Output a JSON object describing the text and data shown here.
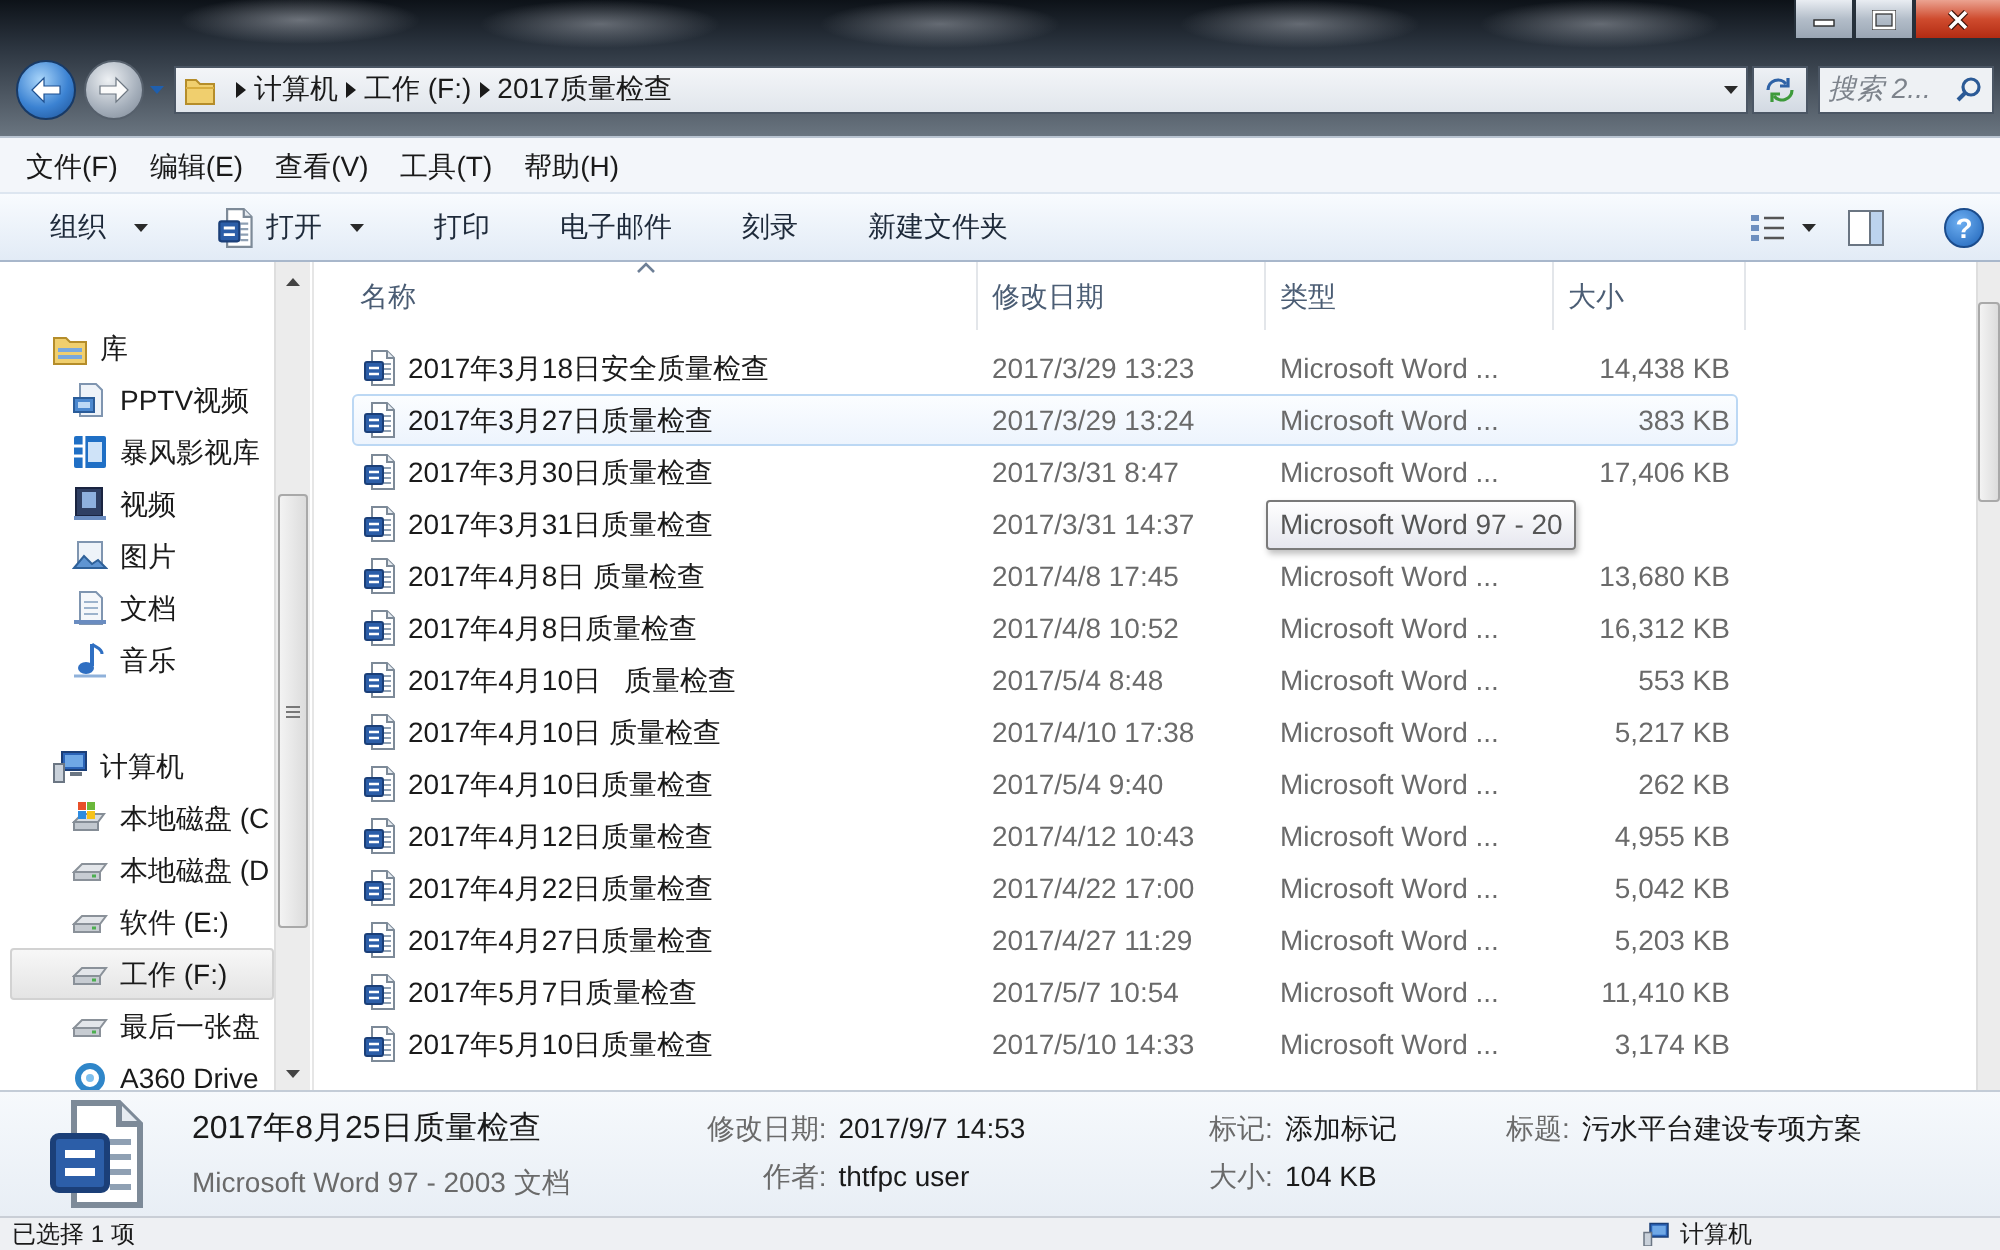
{
  "window": {
    "breadcrumb": [
      "计算机",
      "工作 (F:)",
      "2017质量检查"
    ],
    "search": {
      "placeholder": "搜索 2..."
    }
  },
  "menu": [
    "文件(F)",
    "编辑(E)",
    "查看(V)",
    "工具(T)",
    "帮助(H)"
  ],
  "toolbar": {
    "items": [
      {
        "label": "组织",
        "kind": "menu"
      },
      {
        "label": "打开",
        "kind": "app-menu"
      },
      {
        "label": "打印",
        "kind": "button"
      },
      {
        "label": "电子邮件",
        "kind": "button"
      },
      {
        "label": "刻录",
        "kind": "button"
      },
      {
        "label": "新建文件夹",
        "kind": "button"
      }
    ],
    "help": "?"
  },
  "sidebar": {
    "groups": [
      {
        "label": "库",
        "kind": "library",
        "selected": false,
        "children": [
          {
            "label": "PPTV视频",
            "kind": "video-library",
            "selected": false
          },
          {
            "label": "暴风影视库",
            "kind": "media-library",
            "selected": false
          },
          {
            "label": "视频",
            "kind": "videos",
            "selected": false
          },
          {
            "label": "图片",
            "kind": "pictures",
            "selected": false
          },
          {
            "label": "文档",
            "kind": "documents",
            "selected": false
          },
          {
            "label": "音乐",
            "kind": "music",
            "selected": false
          }
        ]
      },
      {
        "label": "计算机",
        "kind": "computer",
        "selected": false,
        "children": [
          {
            "label": "本地磁盘 (C",
            "kind": "system-drive",
            "selected": false
          },
          {
            "label": "本地磁盘 (D",
            "kind": "drive",
            "selected": false
          },
          {
            "label": "软件 (E:)",
            "kind": "drive",
            "selected": false
          },
          {
            "label": "工作 (F:)",
            "kind": "drive",
            "selected": true
          },
          {
            "label": "最后一张盘",
            "kind": "drive",
            "selected": false
          },
          {
            "label": "A360 Drive",
            "kind": "cloud",
            "selected": false
          }
        ]
      }
    ]
  },
  "file_list": {
    "columns": [
      {
        "label": "名称",
        "sorted": true
      },
      {
        "label": "修改日期",
        "sorted": false
      },
      {
        "label": "类型",
        "sorted": false
      },
      {
        "label": "大小",
        "sorted": false
      }
    ],
    "rows": [
      {
        "name": "2017年3月18日安全质量检查",
        "modified": "2017/3/29 13:23",
        "type": "Microsoft Word ...",
        "size": "14,438 KB",
        "hovered": false
      },
      {
        "name": "2017年3月27日质量检查",
        "modified": "2017/3/29 13:24",
        "type": "Microsoft Word ...",
        "size": "383 KB",
        "hovered": true
      },
      {
        "name": "2017年3月30日质量检查",
        "modified": "2017/3/31 8:47",
        "type": "Microsoft Word ...",
        "size": "17,406 KB",
        "hovered": false
      },
      {
        "name": "2017年3月31日质量检查",
        "modified": "2017/3/31 14:37",
        "tooltip": "Microsoft Word 97 - 20",
        "hovered": false
      },
      {
        "name": "2017年4月8日 质量检查",
        "modified": "2017/4/8 17:45",
        "type": "Microsoft Word ...",
        "size": "13,680 KB",
        "hovered": false
      },
      {
        "name": "2017年4月8日质量检查",
        "modified": "2017/4/8 10:52",
        "type": "Microsoft Word ...",
        "size": "16,312 KB",
        "hovered": false
      },
      {
        "name": "2017年4月10日   质量检查",
        "modified": "2017/5/4 8:48",
        "type": "Microsoft Word ...",
        "size": "553 KB",
        "hovered": false
      },
      {
        "name": "2017年4月10日 质量检查",
        "modified": "2017/4/10 17:38",
        "type": "Microsoft Word ...",
        "size": "5,217 KB",
        "hovered": false
      },
      {
        "name": "2017年4月10日质量检查",
        "modified": "2017/5/4 9:40",
        "type": "Microsoft Word ...",
        "size": "262 KB",
        "hovered": false
      },
      {
        "name": "2017年4月12日质量检查",
        "modified": "2017/4/12 10:43",
        "type": "Microsoft Word ...",
        "size": "4,955 KB",
        "hovered": false
      },
      {
        "name": "2017年4月22日质量检查",
        "modified": "2017/4/22 17:00",
        "type": "Microsoft Word ...",
        "size": "5,042 KB",
        "hovered": false
      },
      {
        "name": "2017年4月27日质量检查",
        "modified": "2017/4/27 11:29",
        "type": "Microsoft Word ...",
        "size": "5,203 KB",
        "hovered": false
      },
      {
        "name": "2017年5月7日质量检查",
        "modified": "2017/5/7 10:54",
        "type": "Microsoft Word ...",
        "size": "11,410 KB",
        "hovered": false
      },
      {
        "name": "2017年5月10日质量检查",
        "modified": "2017/5/10 14:33",
        "type": "Microsoft Word ...",
        "size": "3,174 KB",
        "hovered": false
      }
    ]
  },
  "details": {
    "name": "2017年8月25日质量检查",
    "type": "Microsoft Word 97 - 2003 文档",
    "property_columns": [
      [
        {
          "label": "修改日期:",
          "value": "2017/9/7 14:53"
        },
        {
          "label": "作者:",
          "value": "thtfpc user"
        }
      ],
      [
        {
          "label": "标记:",
          "value": "添加标记"
        },
        {
          "label": "大小:",
          "value": "104 KB"
        }
      ],
      [
        {
          "label": "标题:",
          "value": "污水平台建设专项方案"
        }
      ]
    ]
  },
  "status_bar": {
    "selection": "已选择 1 项",
    "location": "计算机"
  }
}
